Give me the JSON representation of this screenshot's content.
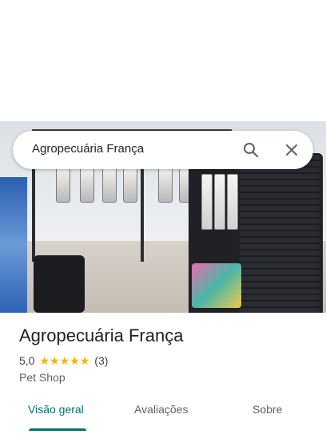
{
  "search": {
    "query": "Agropecuária França"
  },
  "icons": {
    "search": "search-icon",
    "close": "close-icon",
    "star": "star-icon"
  },
  "place": {
    "name": "Agropecuária França",
    "rating": "5,0",
    "stars": 5,
    "review_count": "(3)",
    "category": "Pet Shop"
  },
  "tabs": [
    {
      "label": "Visão geral",
      "active": true
    },
    {
      "label": "Avaliações",
      "active": false
    },
    {
      "label": "Sobre",
      "active": false
    }
  ],
  "colors": {
    "accent": "#01706b",
    "star": "#f4b400",
    "text": "#202124",
    "muted": "#5f6368"
  }
}
